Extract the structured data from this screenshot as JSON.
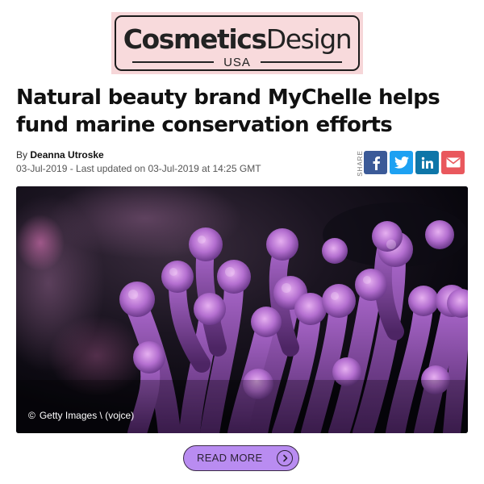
{
  "logo": {
    "word_bold": "Cosmetics",
    "word_light": "Design",
    "region": "USA"
  },
  "article": {
    "headline": "Natural beauty brand MyChelle helps fund marine conservation efforts",
    "byline_prefix": "By",
    "author": "Deanna Utroske",
    "dateline": "03-Jul-2019 - Last updated on 03-Jul-2019 at 14:25 GMT"
  },
  "share": {
    "label": "SHARE",
    "buttons": [
      "facebook",
      "twitter",
      "linkedin",
      "email"
    ]
  },
  "hero": {
    "caption": "Getty Images \\ (vojce)",
    "copyright_symbol": "©"
  },
  "cta": {
    "label": "READ MORE"
  },
  "icons": {
    "facebook": "facebook-icon",
    "twitter": "twitter-icon",
    "linkedin": "linkedin-icon",
    "email": "email-icon",
    "arrow": "chevron-right-icon"
  },
  "colors": {
    "logo_bg": "#f6d6d8",
    "facebook": "#3b5a98",
    "twitter": "#1da1f2",
    "linkedin": "#0e76a8",
    "email": "#e9585d",
    "cta_bg": "#b98cf1"
  }
}
